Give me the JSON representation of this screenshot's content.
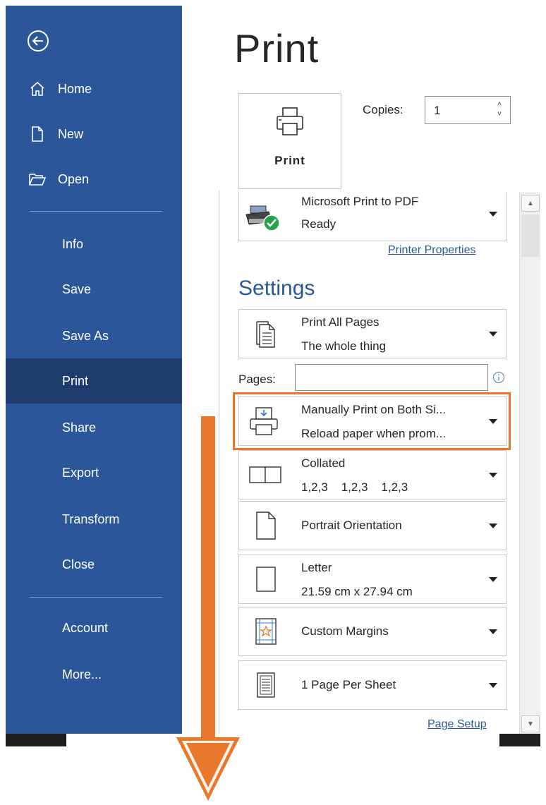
{
  "sidebar": {
    "items": [
      {
        "label": "Home"
      },
      {
        "label": "New"
      },
      {
        "label": "Open"
      },
      {
        "label": "Info"
      },
      {
        "label": "Save"
      },
      {
        "label": "Save As"
      },
      {
        "label": "Print"
      },
      {
        "label": "Share"
      },
      {
        "label": "Export"
      },
      {
        "label": "Transform"
      },
      {
        "label": "Close"
      },
      {
        "label": "Account"
      },
      {
        "label": "More..."
      }
    ]
  },
  "main": {
    "title": "Print",
    "print_button_label": "Print",
    "copies_label": "Copies:",
    "copies_value": "1",
    "printer": {
      "name": "Microsoft Print to PDF",
      "status": "Ready",
      "properties_link": "Printer Properties"
    },
    "settings_title": "Settings",
    "settings": [
      {
        "line1": "Print All Pages",
        "line2": "The whole thing"
      },
      {
        "line1": "Manually Print on Both Si...",
        "line2": "Reload paper when prom..."
      },
      {
        "line1": "Collated",
        "line2": "1,2,3    1,2,3    1,2,3"
      },
      {
        "line1": "Portrait Orientation"
      },
      {
        "line1": "Letter",
        "line2": "21.59 cm x 27.94 cm"
      },
      {
        "line1": "Custom Margins"
      },
      {
        "line1": "1 Page Per Sheet"
      }
    ],
    "pages_label": "Pages:",
    "pages_value": "",
    "page_setup_link": "Page Setup"
  },
  "colors": {
    "sidebar": "#2b579a",
    "sidebar_active": "#1d3c6d",
    "accent": "#2b579a",
    "highlight": "#e8792b"
  }
}
